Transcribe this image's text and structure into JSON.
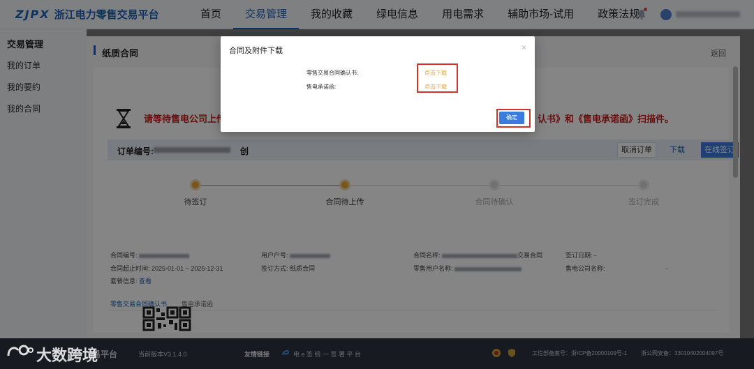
{
  "brand": {
    "mark": "ZJPX",
    "name": "浙江电力零售交易平台"
  },
  "nav": {
    "items": [
      "首页",
      "交易管理",
      "我的收藏",
      "绿电信息",
      "用电需求",
      "辅助市场-试用",
      "政策法规"
    ],
    "active_index": 1
  },
  "sidebar": {
    "title": "交易管理",
    "items": [
      "我的订单",
      "我的要约",
      "我的合同"
    ]
  },
  "page": {
    "title": "纸质合同",
    "back": "返回"
  },
  "notice": {
    "lead": "请等待售电公司上传双方",
    "tail": "认书》和《售电承诺函》扫描件。"
  },
  "order": {
    "label": "订单编号:",
    "suffix": "创",
    "buttons": {
      "cancel": "取消订单",
      "download": "下载",
      "sign": "在线签订"
    }
  },
  "steps": [
    {
      "label": "待签订",
      "done": true
    },
    {
      "label": "合同待上传",
      "done": true
    },
    {
      "label": "合同待确认",
      "done": false
    },
    {
      "label": "签订完成",
      "done": false
    }
  ],
  "info": {
    "contract_no_label": "合同编号:",
    "user_no_label": "用户户号:",
    "contract_name_label": "合同名称:",
    "contract_name_suffix": "交易合同",
    "sign_date_label": "签订日期:",
    "sign_date_value": "-",
    "period_label": "合同起止时间:",
    "period_value": "2025-01-01 ~ 2025-12-31",
    "sign_method_label": "签订方式:",
    "sign_method_value": "纸质合同",
    "retail_user_label": "零售用户名称:",
    "company_label": "售电公司名称:",
    "package_label": "套餐信息:",
    "package_link": "查看",
    "dash": "-"
  },
  "tabs": [
    "零售交易合同确认书",
    "售电承诺函"
  ],
  "footer": {
    "platform_tail": "易平台",
    "version": "当前版本V3.1.4.0",
    "links_label": "友情链接",
    "esign": "电 e 签 统 一 签 署 平 台",
    "icp": "工信部备案号：浙ICP备20000109号-1",
    "police": "浙公网安备：33010402004097号"
  },
  "watermark": "大数跨境",
  "dialog": {
    "title": "合同及附件下载",
    "close": "×",
    "rows": [
      {
        "label": "零售交易合同确认书:",
        "link": "点击下载"
      },
      {
        "label": "售电承诺函:",
        "link": "点击下载"
      }
    ],
    "ok": "确定"
  },
  "colors": {
    "brand": "#1d63b8",
    "warning": "#c8221b",
    "link_orange": "#e8a634",
    "primary_button": "#3a7be0",
    "highlight_box": "#d0332a"
  }
}
